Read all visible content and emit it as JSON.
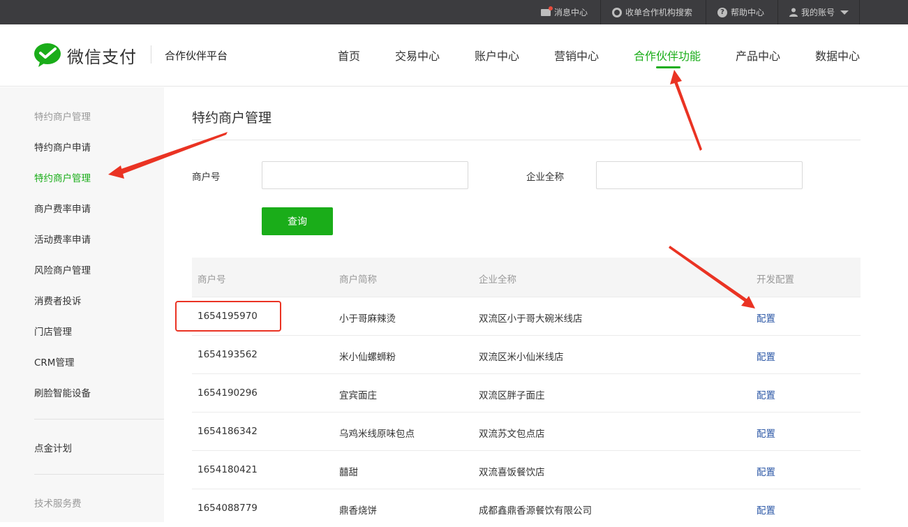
{
  "topbar": {
    "messages": "消息中心",
    "search_org": "收单合作机构搜索",
    "help": "帮助中心",
    "account": "我的账号"
  },
  "header": {
    "logo_text": "微信支付",
    "platform": "合作伙伴平台",
    "nav": [
      "首页",
      "交易中心",
      "账户中心",
      "营销中心",
      "合作伙伴功能",
      "产品中心",
      "数据中心"
    ],
    "active_nav": "合作伙伴功能"
  },
  "sidebar": {
    "group_title": "特约商户管理",
    "items": [
      "特约商户申请",
      "特约商户管理",
      "商户费率申请",
      "活动费率申请",
      "风险商户管理",
      "消费者投诉",
      "门店管理",
      "CRM管理",
      "刷脸智能设备"
    ],
    "active_item": "特约商户管理",
    "extra": "点金计划",
    "group_title_2": "技术服务费"
  },
  "main": {
    "title": "特约商户管理",
    "form": {
      "merchant_no_label": "商户号",
      "merchant_no_value": "",
      "company_label": "企业全称",
      "company_value": "",
      "query_button": "查询"
    },
    "table": {
      "headers": [
        "商户号",
        "商户简称",
        "企业全称",
        "开发配置"
      ],
      "rows": [
        {
          "id": "1654195970",
          "short": "小于哥麻辣烫",
          "full": "双流区小于哥大碗米线店",
          "action": "配置"
        },
        {
          "id": "1654193562",
          "short": "米小仙螺蛳粉",
          "full": "双流区米小仙米线店",
          "action": "配置"
        },
        {
          "id": "1654190296",
          "short": "宜宾面庄",
          "full": "双流区胖子面庄",
          "action": "配置"
        },
        {
          "id": "1654186342",
          "short": "乌鸡米线原味包点",
          "full": "双流苏文包点店",
          "action": "配置"
        },
        {
          "id": "1654180421",
          "short": "囍甜",
          "full": "双流喜饭餐饮店",
          "action": "配置"
        },
        {
          "id": "1654088779",
          "short": "鼎香烧饼",
          "full": "成都鑫鼎香源餐饮有限公司",
          "action": "配置"
        }
      ]
    }
  },
  "colors": {
    "brand_green": "#1aad19",
    "link_blue": "#2e59a7",
    "annotation_red": "#ea3323",
    "topbar_bg": "#3c3c3f"
  }
}
